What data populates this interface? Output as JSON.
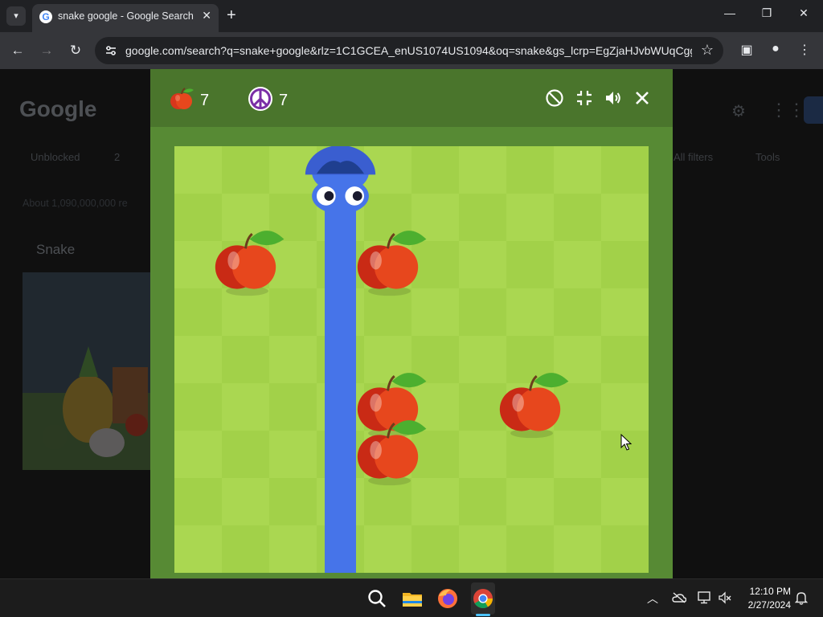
{
  "browser": {
    "tab_title": "snake google - Google Search",
    "tab_favicon": "G",
    "url": "google.com/search?q=snake+google&rlz=1C1GCEA_enUS1074US1094&oq=snake&gs_lcrp=EgZjaHJvbWUqCgg...",
    "icons": {
      "tab_list": "chevron-down-icon",
      "new_tab": "plus-icon",
      "minimize": "minimize-icon",
      "restore": "restore-icon",
      "close": "close-icon",
      "back": "arrow-left-icon",
      "forward": "arrow-right-icon",
      "reload": "reload-icon",
      "site_info": "tune-icon",
      "bookmark": "star-icon",
      "side_panel": "side-panel-icon",
      "profile": "profile-icon",
      "menu": "kebab-menu-icon"
    }
  },
  "google_page": {
    "logo": "Google",
    "filters": [
      "Unblocked",
      "2",
      "All filters",
      "Tools"
    ],
    "result_count": "About 1,090,000,000 re",
    "heading": "Snake"
  },
  "game": {
    "score": "7",
    "high_score": "7",
    "colors": {
      "header": "#4a752c",
      "frame": "#578a34",
      "tile_light": "#aad751",
      "tile_dark": "#a2d149",
      "snake": "#4674e9",
      "apple": "#e7471d"
    },
    "controls": [
      "no-walls-icon",
      "exit-fullscreen-icon",
      "volume-icon",
      "close-icon"
    ],
    "grid": {
      "columns": 10,
      "rows": 9
    },
    "snake_cells": [
      [
        3,
        0
      ],
      [
        3,
        1
      ],
      [
        3,
        2
      ],
      [
        3,
        3
      ],
      [
        3,
        4
      ],
      [
        3,
        5
      ],
      [
        3,
        6
      ],
      [
        3,
        7
      ],
      [
        3,
        8
      ]
    ],
    "snake_direction": "up",
    "apples": [
      [
        1,
        2
      ],
      [
        4,
        2
      ],
      [
        4,
        5
      ],
      [
        4,
        6
      ],
      [
        7,
        5
      ]
    ]
  },
  "taskbar": {
    "apps": [
      "search-icon",
      "file-explorer-icon",
      "firefox-icon",
      "chrome-icon"
    ],
    "active_app": "chrome-icon",
    "tray": [
      "chevron-up-icon",
      "onedrive-icon",
      "network-icon",
      "volume-muted-icon",
      "notifications-icon"
    ],
    "time": "12:10 PM",
    "date": "2/27/2024"
  }
}
